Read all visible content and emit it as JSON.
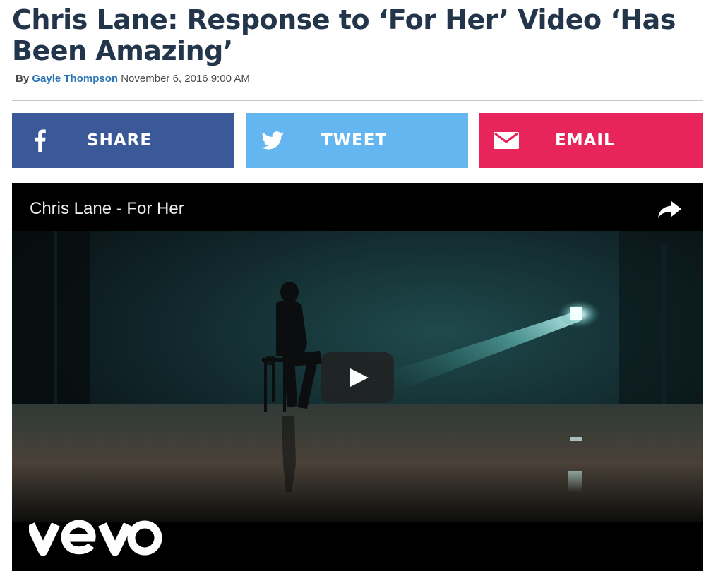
{
  "article": {
    "headline": "Chris Lane: Response to ‘For Her’ Video ‘Has Been Amazing’",
    "byline_prefix": "By",
    "author": "Gayle Thompson",
    "date": "November 6, 2016 9:00 AM"
  },
  "share": {
    "facebook": {
      "label": "SHARE",
      "icon": "facebook-icon",
      "color": "#3b5998"
    },
    "twitter": {
      "label": "TWEET",
      "icon": "twitter-bird-icon",
      "color": "#63b6f0"
    },
    "email": {
      "label": "EMAIL",
      "icon": "envelope-icon",
      "color": "#e8255a"
    }
  },
  "video": {
    "title": "Chris Lane - For Her",
    "share_icon": "share-arrow-icon",
    "play_icon": "play-icon",
    "logo": "vevo"
  },
  "colors": {
    "headline": "#22354a",
    "author_link": "#2a74b6"
  }
}
